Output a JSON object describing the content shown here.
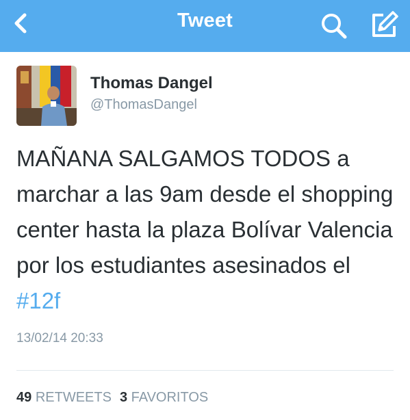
{
  "header": {
    "title": "Tweet",
    "background": "#55acee"
  },
  "tweet": {
    "author": {
      "name": "Thomas Dangel",
      "handle": "@ThomasDangel"
    },
    "text_before_hashtag": "MAÑANA SALGAMOS TODOS a marchar a las 9am desde el shopping center hasta la plaza Bolívar Valencia por los estudiantes asesinados el ",
    "hashtag": "#12f",
    "timestamp": "13/02/14 20:33",
    "stats": {
      "retweets_count": "49",
      "retweets_label": "RETWEETS",
      "favorites_count": "3",
      "favorites_label": "FAVORITOS"
    }
  },
  "icons": {
    "back": "chevron-left-icon",
    "search": "search-icon",
    "compose": "compose-icon"
  },
  "colors": {
    "accent": "#55acee",
    "text": "#292f33",
    "muted": "#8899a6"
  }
}
